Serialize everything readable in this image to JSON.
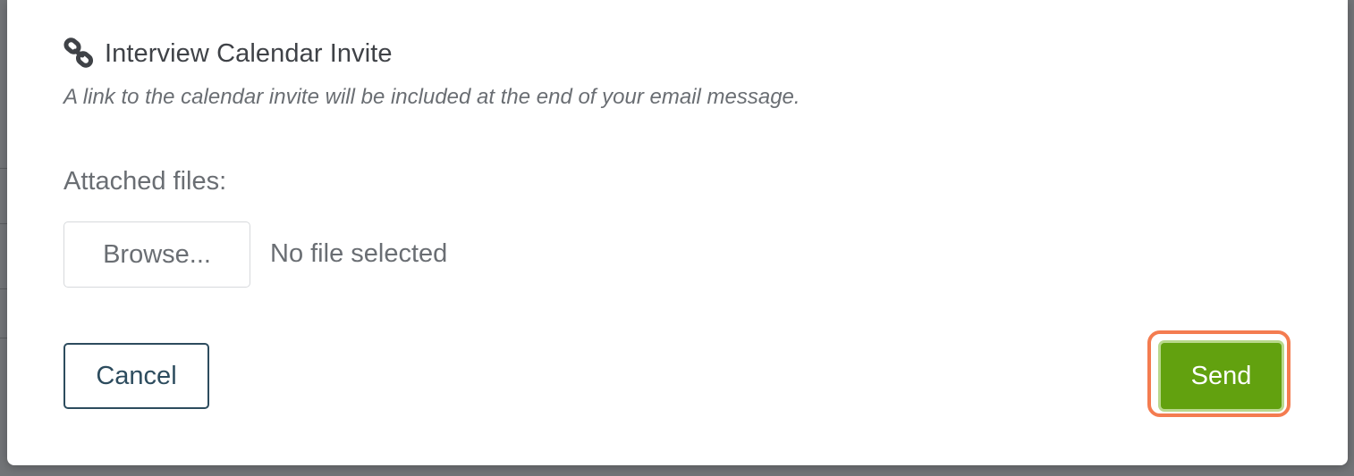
{
  "calendar_invite": {
    "title": "Interview Calendar Invite",
    "description": "A link to the calendar invite will be included at the end of your email message.",
    "icon": "link-icon"
  },
  "attachments": {
    "label": "Attached files:",
    "browse_label": "Browse...",
    "status": "No file selected"
  },
  "actions": {
    "cancel_label": "Cancel",
    "send_label": "Send"
  },
  "colors": {
    "send_button": "#62a10f",
    "cancel_border": "#2d4c5e",
    "highlight": "#f47c50"
  }
}
